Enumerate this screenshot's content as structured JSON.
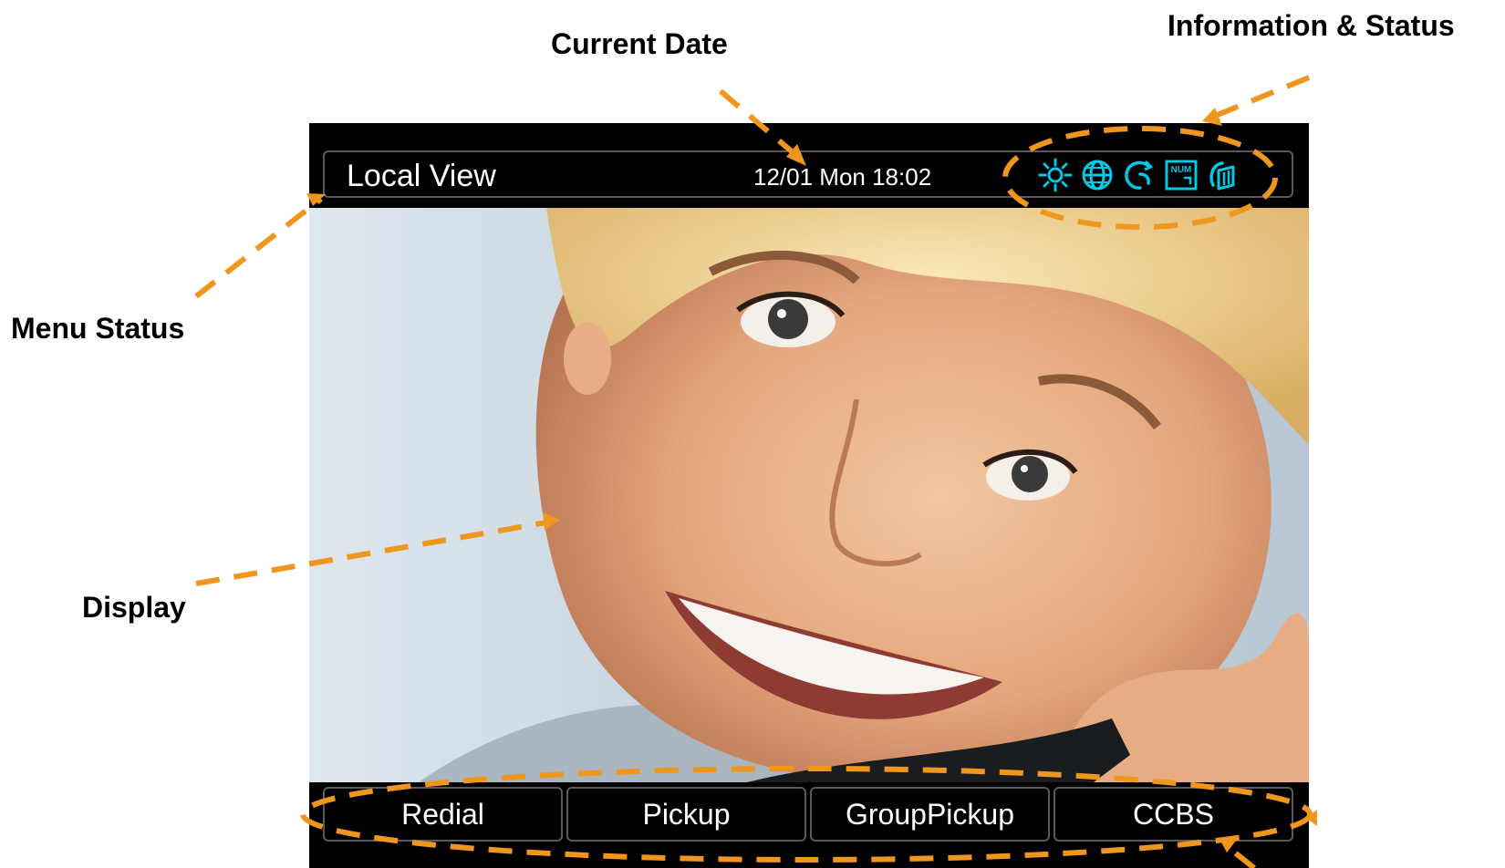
{
  "callouts": {
    "current_date": "Current Date",
    "information_status": "Information & Status",
    "menu_status": "Menu Status",
    "display": "Display"
  },
  "screen": {
    "menu_title": "Local View",
    "date_time": "12/01 Mon 18:02",
    "status_icons": [
      "brightness-icon",
      "globe-icon",
      "call-forward-icon",
      "num-lock-icon",
      "headset-icon"
    ],
    "num_label": "NUM",
    "softkeys": [
      "Redial",
      "Pickup",
      "GroupPickup",
      "CCBS"
    ]
  },
  "colors": {
    "accent_orange": "#F0961E",
    "icon_cyan": "#00C8E6",
    "screen_bg": "#000000"
  }
}
